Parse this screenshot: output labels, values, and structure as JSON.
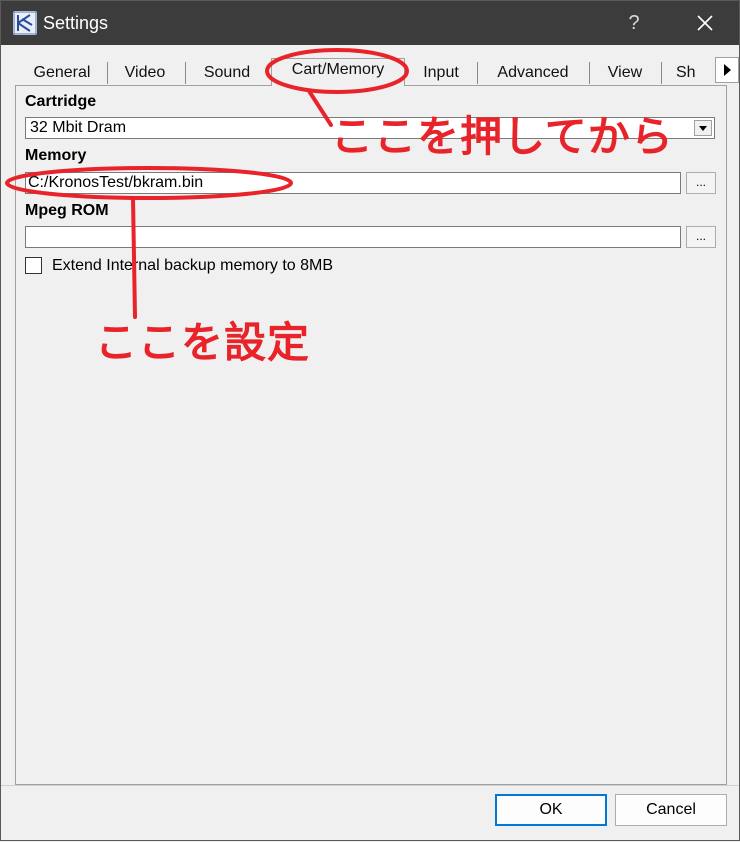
{
  "window": {
    "title": "Settings",
    "help_label": "?",
    "close_icon": "close-icon"
  },
  "tabs": [
    {
      "label": "General"
    },
    {
      "label": "Video"
    },
    {
      "label": "Sound"
    },
    {
      "label": "Cart/Memory",
      "selected": true
    },
    {
      "label": "Input"
    },
    {
      "label": "Advanced"
    },
    {
      "label": "View"
    },
    {
      "label": "Sh"
    }
  ],
  "cartridge": {
    "label": "Cartridge",
    "value": "32 Mbit Dram"
  },
  "memory": {
    "label": "Memory",
    "value": "C:/KronosTest/bkram.bin",
    "browse_label": "..."
  },
  "mpeg_rom": {
    "label": "Mpeg ROM",
    "value": "",
    "browse_label": "..."
  },
  "extend_backup": {
    "label": "Extend Internal backup memory to 8MB",
    "checked": false
  },
  "buttons": {
    "ok": "OK",
    "cancel": "Cancel"
  },
  "annotations": {
    "press_here": "ここを押してから",
    "set_here": "ここを設定",
    "color": "#e8232a"
  }
}
